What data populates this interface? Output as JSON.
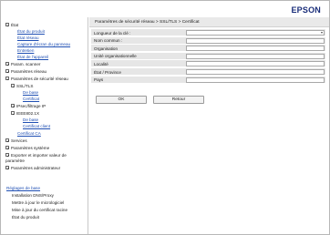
{
  "header": {
    "brand": "EPSON"
  },
  "sidebar": {
    "status": {
      "label": "État",
      "children": [
        "État du produit",
        "État réseau",
        "Capture d'écran du panneau",
        "Entretien",
        "État de l'appareil"
      ]
    },
    "scan_param": "Param. scanner",
    "network_params": "Paramètres réseau",
    "network_security": {
      "label": "Paramètres de sécurité réseau",
      "ssl": {
        "label": "SSL/TLS",
        "children": [
          "De base",
          "Certificat"
        ]
      },
      "ipsec": "IPsec/filtrage IP",
      "ieee": {
        "label": "IEEE802.1X",
        "children": [
          "De base",
          "Certificat client"
        ]
      },
      "ca_cert": "Certificat CA"
    },
    "services": "Services",
    "system_params": "Paramètres système",
    "export_import": [
      "Exporter et importer valeur de",
      "paramètre"
    ],
    "admin_params": "Paramètres administrateur",
    "basic_settings": "Réglages de base",
    "links": [
      "Installation DNS/Proxy",
      "Mettre à jour le micrologiciel",
      "Mise à jour du certificat racine",
      "État du produit"
    ]
  },
  "main": {
    "breadcrumb": "Paramètres de sécurité réseau > SSL/TLS > Certificat",
    "fields": [
      {
        "label": "Longueur de la clé :",
        "type": "select",
        "value": ""
      },
      {
        "label": "Nom commun :",
        "type": "text",
        "value": ""
      },
      {
        "label": "Organisation",
        "type": "text",
        "value": ""
      },
      {
        "label": "Unité organisationnelle",
        "type": "text",
        "value": ""
      },
      {
        "label": "Localité",
        "type": "text",
        "value": ""
      },
      {
        "label": "État / Province",
        "type": "text",
        "value": ""
      },
      {
        "label": "Pays",
        "type": "text",
        "value": ""
      }
    ],
    "ok_label": "OK",
    "back_label": "Retour"
  }
}
